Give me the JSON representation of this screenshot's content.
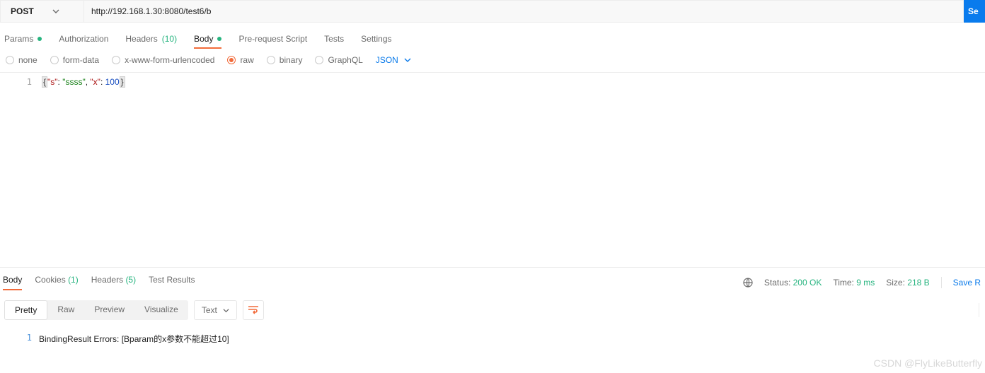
{
  "request": {
    "method": "POST",
    "url": "http://192.168.1.30:8080/test6/b",
    "send_label": "Se"
  },
  "req_tabs": {
    "params": "Params",
    "auth": "Authorization",
    "headers": "Headers",
    "headers_count": "(10)",
    "body": "Body",
    "prereq": "Pre-request Script",
    "tests": "Tests",
    "settings": "Settings"
  },
  "body_types": {
    "none": "none",
    "formdata": "form-data",
    "urlenc": "x-www-form-urlencoded",
    "raw": "raw",
    "binary": "binary",
    "graphql": "GraphQL",
    "lang": "JSON"
  },
  "editor": {
    "line_number": "1",
    "open": "{",
    "k1": "\"s\"",
    "colon": ": ",
    "v1": "\"ssss\"",
    "comma": ", ",
    "k2": "\"x\"",
    "v2": "100",
    "close": "}"
  },
  "resp_tabs": {
    "body": "Body",
    "cookies": "Cookies",
    "cookies_count": "(1)",
    "headers": "Headers",
    "headers_count": "(5)",
    "test_results": "Test Results"
  },
  "status": {
    "status_label": "Status:",
    "status_value": "200 OK",
    "time_label": "Time:",
    "time_value": "9 ms",
    "size_label": "Size:",
    "size_value": "218 B",
    "save": "Save R"
  },
  "resp_toolbar": {
    "pretty": "Pretty",
    "raw": "Raw",
    "preview": "Preview",
    "visualize": "Visualize",
    "format": "Text"
  },
  "response": {
    "line_number": "1",
    "text": "BindingResult Errors: [Bparam的x参数不能超过10]"
  },
  "watermark": "CSDN @FlyLikeButterfly"
}
